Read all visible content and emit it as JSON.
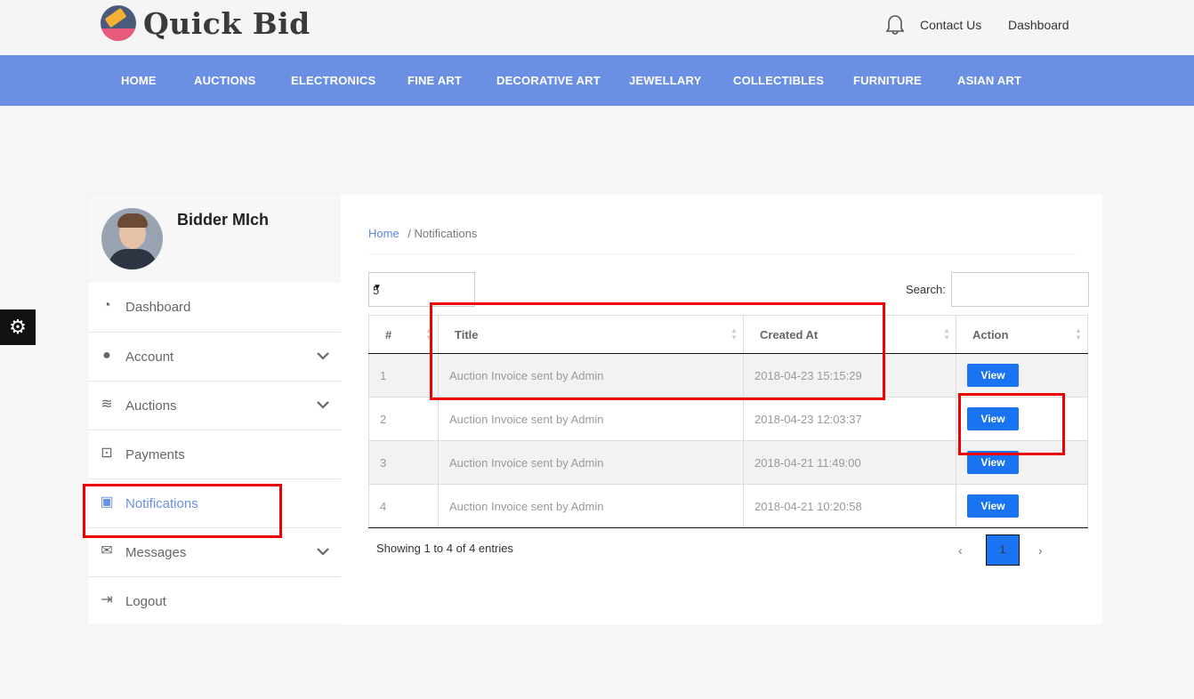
{
  "header": {
    "logo_text": "Quick Bid",
    "links": [
      "Contact Us",
      "Dashboard"
    ]
  },
  "nav": {
    "items": [
      "HOME",
      "AUCTIONS",
      "ELECTRONICS",
      "FINE ART",
      "DECORATIVE ART",
      "JEWELLARY",
      "COLLECTIBLES",
      "FURNITURE",
      "ASIAN ART"
    ]
  },
  "sidebar": {
    "username": "Bidder MIch",
    "items": [
      {
        "label": "Dashboard",
        "icon": "dashboard-icon"
      },
      {
        "label": "Account",
        "icon": "globe-icon"
      },
      {
        "label": "Auctions",
        "icon": "database-icon"
      },
      {
        "label": "Payments",
        "icon": "money-icon"
      },
      {
        "label": "Notifications",
        "icon": "briefcase-icon"
      },
      {
        "label": "Messages",
        "icon": "envelope-icon"
      },
      {
        "label": "Logout",
        "icon": "sign-out-icon"
      }
    ]
  },
  "main": {
    "breadcrumb": {
      "home": "Home",
      "current": "/ Notifications"
    },
    "page_size": "5",
    "search_label": "Search:",
    "table": {
      "headers": [
        "#",
        "Title",
        "Created At",
        "Action"
      ],
      "rows": [
        {
          "num": "1",
          "title": "Auction Invoice sent by Admin",
          "created": "2018-04-23 15:15:29",
          "action": "View"
        },
        {
          "num": "2",
          "title": "Auction Invoice sent by Admin",
          "created": "2018-04-23 12:03:37",
          "action": "View"
        },
        {
          "num": "3",
          "title": "Auction Invoice sent by Admin",
          "created": "2018-04-21 11:49:00",
          "action": "View"
        },
        {
          "num": "4",
          "title": "Auction Invoice sent by Admin",
          "created": "2018-04-21 10:20:58",
          "action": "View"
        }
      ]
    },
    "entries_info": "Showing 1 to 4 of 4 entries",
    "pagination": {
      "prev": "‹",
      "current": "1",
      "next": "›"
    }
  },
  "colors": {
    "nav_bg": "#6a8fe3",
    "button": "#1a73f0",
    "annotation": "#e00000",
    "active_link": "#6a8fe3"
  }
}
